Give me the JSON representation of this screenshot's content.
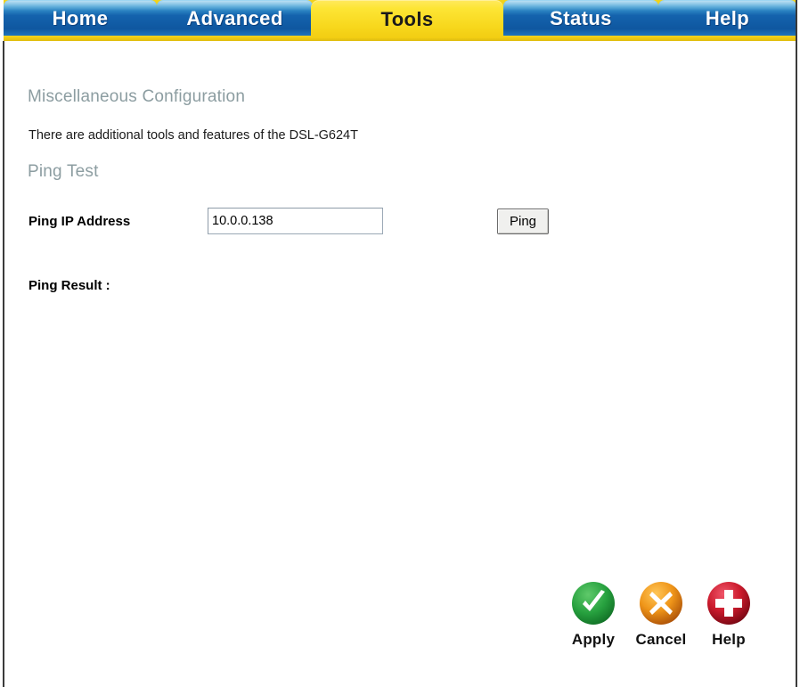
{
  "nav": {
    "tabs": [
      {
        "id": "home",
        "label": "Home",
        "active": false
      },
      {
        "id": "advanced",
        "label": "Advanced",
        "active": false
      },
      {
        "id": "tools",
        "label": "Tools",
        "active": true
      },
      {
        "id": "status",
        "label": "Status",
        "active": false
      },
      {
        "id": "help",
        "label": "Help",
        "active": false
      }
    ],
    "active_tab": "Tools",
    "active_color": "#f7d71c",
    "inactive_color": "#1463ad",
    "underbar_color": "#f3d11a"
  },
  "main": {
    "section_title": "Miscellaneous Configuration",
    "intro_text": "There are additional tools and features of the DSL-G624T",
    "subsection_title": "Ping Test",
    "heading_color": "#8c9da1",
    "ping": {
      "ip_label": "Ping IP Address",
      "ip_value": "10.0.0.138",
      "ip_placeholder": "",
      "button_label": "Ping",
      "result_label": "Ping Result :",
      "result_value": ""
    }
  },
  "actions": [
    {
      "id": "apply",
      "label": "Apply",
      "icon": "check-circle-icon",
      "color": "#1f9a3c"
    },
    {
      "id": "cancel",
      "label": "Cancel",
      "icon": "x-circle-icon",
      "color": "#e8921b"
    },
    {
      "id": "help",
      "label": "Help",
      "icon": "plus-circle-icon",
      "color": "#c5162a"
    }
  ]
}
